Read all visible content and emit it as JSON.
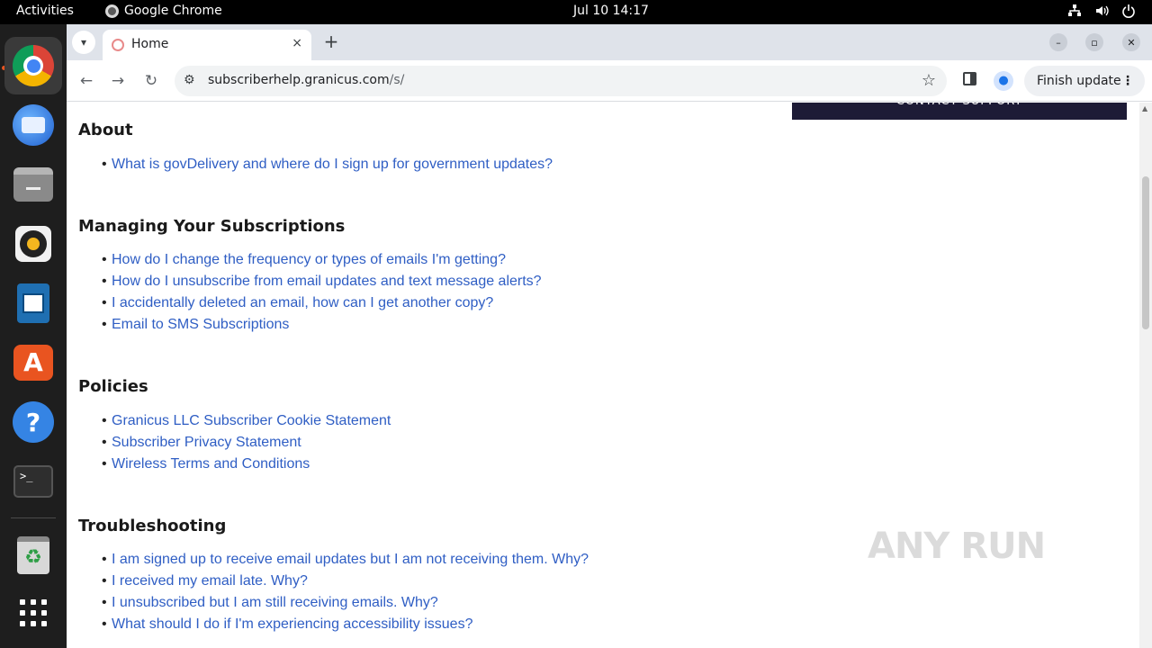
{
  "topbar": {
    "activities": "Activities",
    "app_name": "Google Chrome",
    "clock": "Jul 10  14:17",
    "tray_icons": [
      "network-icon",
      "volume-icon",
      "power-icon"
    ]
  },
  "dock": {
    "items": [
      "chrome-icon",
      "thunderbird-icon",
      "files-icon",
      "rhythmbox-icon",
      "writer-icon",
      "app-center-icon",
      "help-icon",
      "terminal-icon",
      "trash-icon",
      "app-grid-icon"
    ]
  },
  "browser": {
    "tab_title": "Home",
    "tab_close": "×",
    "new_tab": "+",
    "url_host": "subscriberhelp.granicus.com",
    "url_path": "/s/",
    "finish_update": "Finish update",
    "minimize": "–",
    "maximize": "▫",
    "close": "✕"
  },
  "page": {
    "contact_button": "CONTACT SUPPORT",
    "sections": [
      {
        "heading": "About",
        "links": [
          "What is govDelivery and where do I sign up for government updates?"
        ]
      },
      {
        "heading": "Managing Your Subscriptions",
        "links": [
          "How do I change the frequency or types of emails I'm getting?",
          "How do I unsubscribe from email updates and text message alerts?",
          "I accidentally deleted an email, how can I get another copy?",
          "Email to SMS Subscriptions"
        ]
      },
      {
        "heading": "Policies",
        "links": [
          "Granicus LLC Subscriber Cookie Statement",
          "Subscriber Privacy Statement",
          "Wireless Terms and Conditions"
        ]
      },
      {
        "heading": "Troubleshooting",
        "links": [
          "I am signed up to receive email updates but I am not receiving them. Why?",
          "I received my email late. Why?",
          "I unsubscribed but I am still receiving emails. Why?",
          "What should I do if I'm experiencing accessibility issues?"
        ]
      }
    ]
  },
  "watermark": "ANY RUN",
  "colors": {
    "link": "#2f5ec4",
    "contact_bg": "#1d1b36",
    "accent": "#e95420"
  }
}
